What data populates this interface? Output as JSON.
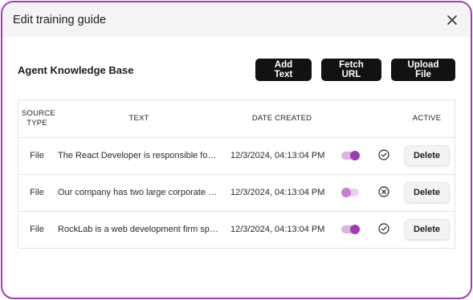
{
  "modal": {
    "title": "Edit training guide"
  },
  "knowledge_base": {
    "title": "Agent Knowledge Base",
    "actions": [
      "Add Text",
      "Fetch URL",
      "Upload File"
    ]
  },
  "table": {
    "headers": {
      "source_type": "SOURCE TYPE",
      "text": "TEXT",
      "date_created": "DATE CREATED",
      "active": "ACTIVE"
    },
    "rows": [
      {
        "source_type": "File",
        "text": "The React Developer is responsible for…",
        "date_created": "12/3/2024, 04:13:04 PM",
        "active": true,
        "status_icon": "check-circle-icon",
        "delete_label": "Delete"
      },
      {
        "source_type": "File",
        "text": "Our company has two large corporate …",
        "date_created": "12/3/2024, 04:13:04 PM",
        "active": false,
        "status_icon": "x-circle-icon",
        "delete_label": "Delete"
      },
      {
        "source_type": "File",
        "text": "RockLab is a web development firm sp…",
        "date_created": "12/3/2024, 04:13:04 PM",
        "active": true,
        "status_icon": "check-circle-icon",
        "delete_label": "Delete"
      }
    ]
  },
  "colors": {
    "accent": "#a13bb2",
    "toggle_track_on": "#dcb3e2",
    "toggle_track_off": "#e9d2ed",
    "button_dark": "#121212",
    "header_bg": "#f4f4f4"
  }
}
